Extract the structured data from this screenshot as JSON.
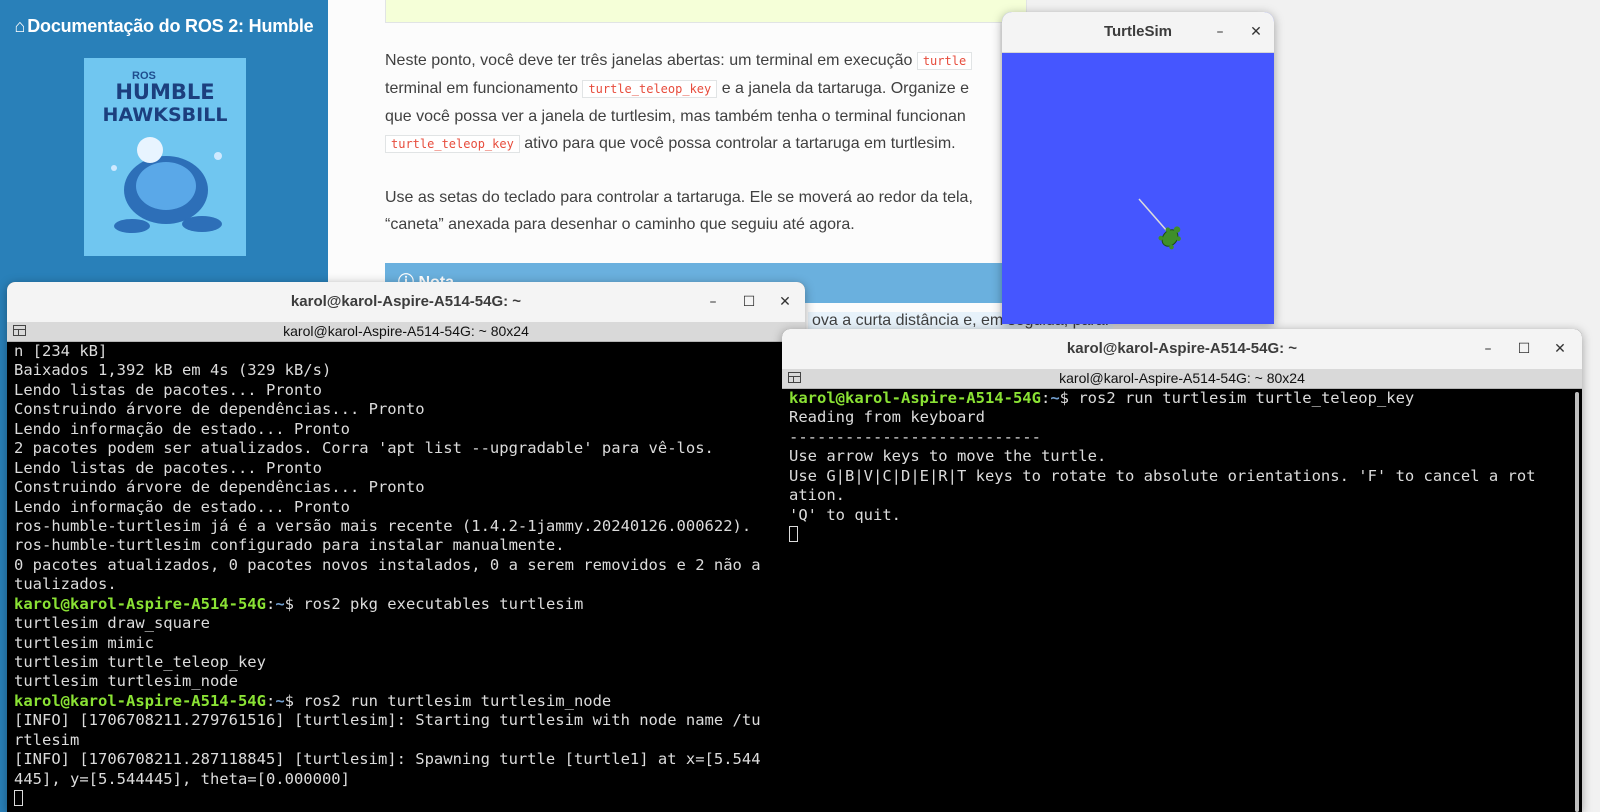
{
  "doc": {
    "title": "Documentação do ROS 2: Humble",
    "logo": {
      "line1": "HUMBLE",
      "line2": "HAWKSBILL",
      "ros": "ROS"
    },
    "para1": {
      "p1": "Neste ponto, você deve ter três janelas abertas: um terminal em execução ",
      "c1": "turtle",
      "p2": "terminal em funcionamento ",
      "c2": "turtle_teleop_key",
      "p3": " e a janela da tartaruga. Organize e",
      "p4": "que você possa ver a janela de turtlesim, mas também tenha o terminal funcionan",
      "c3": "turtle_teleop_key",
      "p5": " ativo para que você possa controlar a tartaruga em turtlesim."
    },
    "para2": {
      "l1": "Use as setas do teclado para controlar a tartaruga. Ele se moverá ao redor da tela,",
      "l2": "“caneta” anexada para desenhar o caminho que seguiu até agora."
    },
    "note_title": "Nota",
    "note_text": "ova a curta distância e, em seguida, para."
  },
  "terminal_left": {
    "window_title": "karol@karol-Aspire-A514-54G: ~",
    "tab_title": "karol@karol-Aspire-A514-54G: ~ 80x24",
    "lines": [
      "n [234 kB]",
      "Baixados 1,392 kB em 4s (329 kB/s)",
      "Lendo listas de pacotes... Pronto",
      "Construindo árvore de dependências... Pronto",
      "Lendo informação de estado... Pronto",
      "2 pacotes podem ser atualizados. Corra 'apt list --upgradable' para vê-los.",
      "Lendo listas de pacotes... Pronto",
      "Construindo árvore de dependências... Pronto",
      "Lendo informação de estado... Pronto",
      "ros-humble-turtlesim já é a versão mais recente (1.4.2-1jammy.20240126.000622).",
      "ros-humble-turtlesim configurado para instalar manualmente.",
      "0 pacotes atualizados, 0 pacotes novos instalados, 0 a serem removidos e 2 não a",
      "tualizados.",
      {
        "user": "karol@karol-Aspire-A514-54G",
        "path": "~",
        "cmd": "$ ros2 pkg executables turtlesim"
      },
      "turtlesim draw_square",
      "turtlesim mimic",
      "turtlesim turtle_teleop_key",
      "turtlesim turtlesim_node",
      {
        "user": "karol@karol-Aspire-A514-54G",
        "path": "~",
        "cmd": "$ ros2 run turtlesim turtlesim_node"
      },
      "[INFO] [1706708211.279761516] [turtlesim]: Starting turtlesim with node name /tu",
      "rtlesim",
      "[INFO] [1706708211.287118845] [turtlesim]: Spawning turtle [turtle1] at x=[5.544",
      "445], y=[5.544445], theta=[0.000000]"
    ]
  },
  "terminal_right": {
    "window_title": "karol@karol-Aspire-A514-54G: ~",
    "tab_title": "karol@karol-Aspire-A514-54G: ~ 80x24",
    "lines": [
      {
        "user": "karol@karol-Aspire-A514-54G",
        "path": "~",
        "cmd": "$ ros2 run turtlesim turtle_teleop_key"
      },
      "Reading from keyboard",
      "---------------------------",
      "Use arrow keys to move the turtle.",
      "Use G|B|V|C|D|E|R|T keys to rotate to absolute orientations. 'F' to cancel a rot",
      "ation.",
      "'Q' to quit."
    ]
  },
  "turtlesim": {
    "window_title": "TurtleSim",
    "background": "#4556ff",
    "pen_color": "#dcdcdc",
    "turtle_color": "#3f8f2a"
  },
  "window_controls": {
    "minimize": "–",
    "maximize": "☐",
    "close": "✕"
  }
}
